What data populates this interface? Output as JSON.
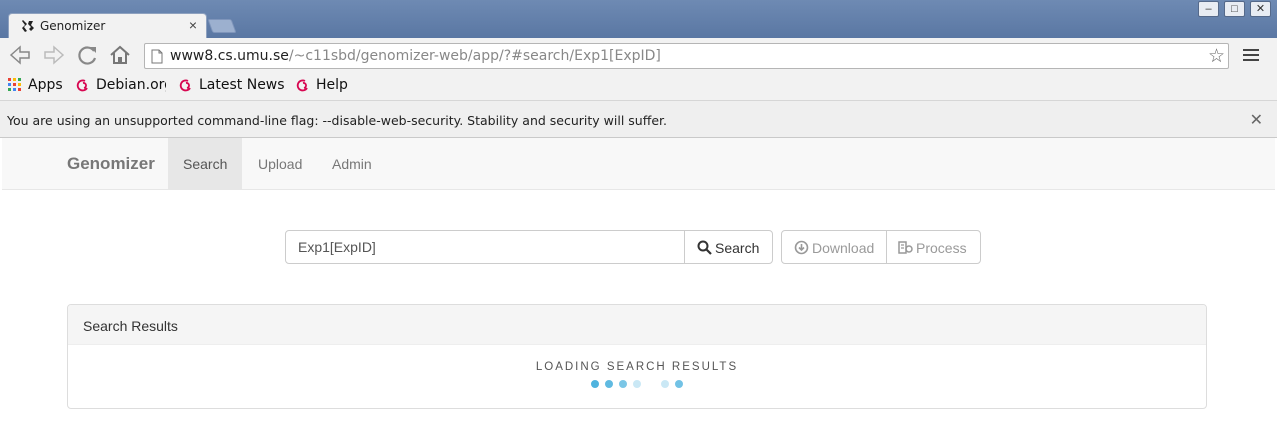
{
  "browser": {
    "tab_title": "Genomizer",
    "url_host": "www8.cs.umu.se",
    "url_path": "/~c11sbd/genomizer-web/app/?#search/Exp1[ExpID]",
    "bookmarks": [
      {
        "label": "Apps",
        "icon": "apps-grid-icon"
      },
      {
        "label": "Debian.org",
        "icon": "debian-swirl-icon"
      },
      {
        "label": "Latest News",
        "icon": "debian-swirl-icon"
      },
      {
        "label": "Help",
        "icon": "debian-swirl-icon"
      }
    ],
    "infobar_text": "You are using an unsupported command-line flag: --disable-web-security. Stability and security will suffer.",
    "colors": {
      "accent_frame": "#5a77a3",
      "debian_red": "#d70751"
    }
  },
  "app": {
    "brand": "Genomizer",
    "nav": [
      {
        "label": "Search",
        "active": true
      },
      {
        "label": "Upload",
        "active": false
      },
      {
        "label": "Admin",
        "active": false
      }
    ],
    "search": {
      "query": "Exp1[ExpID]",
      "button_label": "Search",
      "download_label": "Download",
      "process_label": "Process"
    },
    "results": {
      "heading": "Search Results",
      "loading_text": "LOADING SEARCH RESULTS",
      "loader_color": "#4fb3de"
    }
  }
}
